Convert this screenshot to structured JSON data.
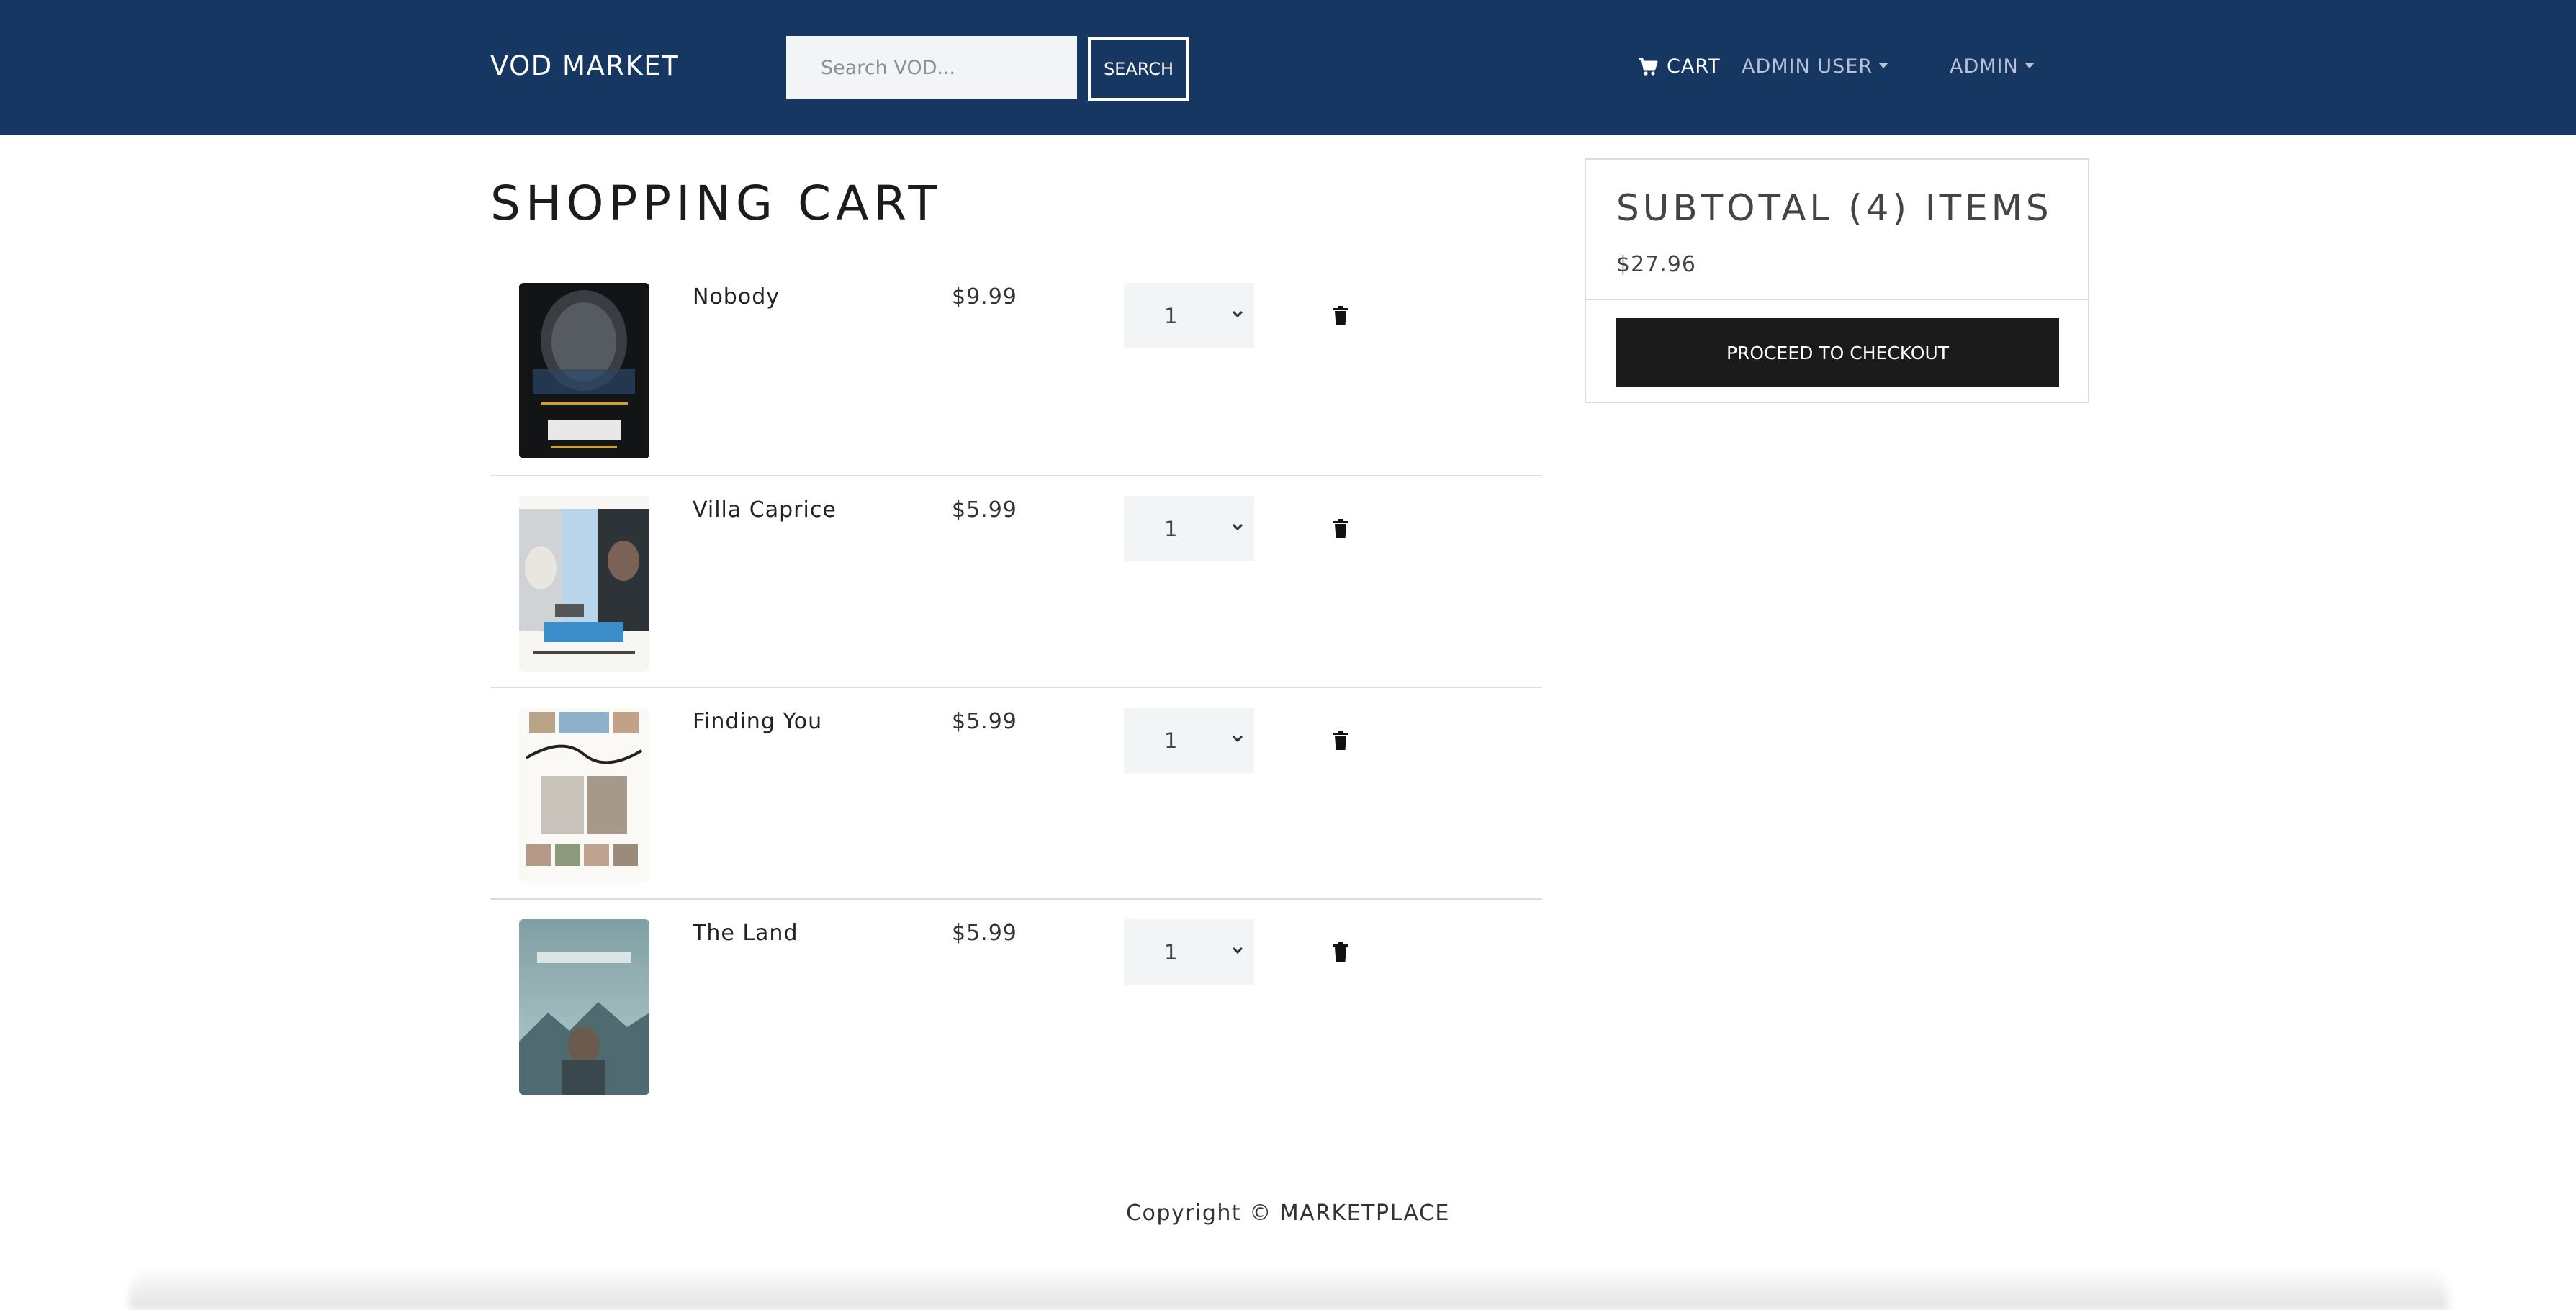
{
  "navbar": {
    "brand": "VOD MARKET",
    "search_placeholder": "Search VOD...",
    "search_button": "SEARCH",
    "cart_label": "CART",
    "user_menu": "ADMIN USER",
    "admin_menu": "ADMIN"
  },
  "page": {
    "title": "SHOPPING CART"
  },
  "cart": {
    "items": [
      {
        "title": "Nobody",
        "price": "$9.99",
        "qty": "1"
      },
      {
        "title": "Villa Caprice",
        "price": "$5.99",
        "qty": "1"
      },
      {
        "title": "Finding You",
        "price": "$5.99",
        "qty": "1"
      },
      {
        "title": "The Land",
        "price": "$5.99",
        "qty": "1"
      }
    ]
  },
  "summary": {
    "heading": "SUBTOTAL (4) ITEMS",
    "total": "$27.96",
    "checkout_button": "PROCEED TO CHECKOUT"
  },
  "footer": {
    "text": "Copyright © MARKETPLACE"
  },
  "colors": {
    "navbar": "#173763",
    "button_dark": "#1b1b1b",
    "input_bg": "#f3f4f6"
  }
}
